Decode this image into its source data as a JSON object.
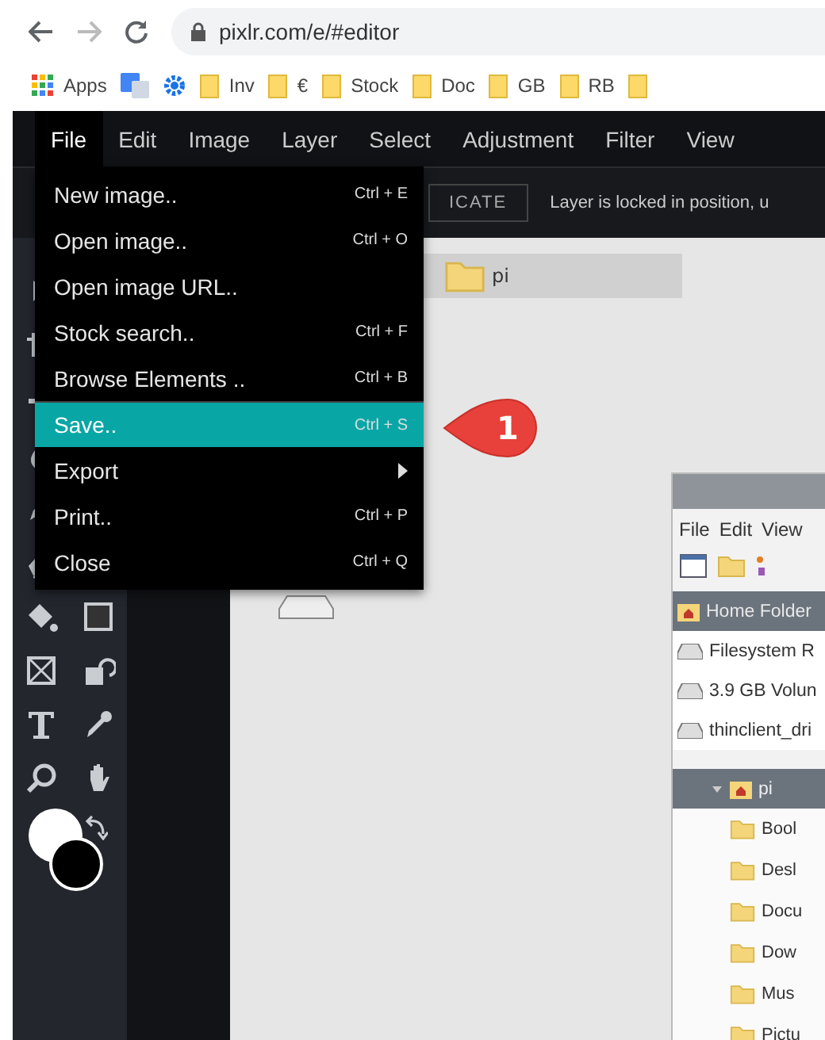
{
  "browser": {
    "url": "pixlr.com/e/#editor",
    "bookmarks": [
      {
        "label": "Apps",
        "kind": "apps"
      },
      {
        "kind": "translate"
      },
      {
        "kind": "gear"
      },
      {
        "label": "Inv",
        "kind": "folder"
      },
      {
        "label": "€",
        "kind": "folder"
      },
      {
        "label": "Stock",
        "kind": "folder"
      },
      {
        "label": "Doc",
        "kind": "folder"
      },
      {
        "label": "GB",
        "kind": "folder"
      },
      {
        "label": "RB",
        "kind": "folder"
      }
    ]
  },
  "menu_bar": [
    {
      "label": "File",
      "selected": true
    },
    {
      "label": "Edit",
      "selected": false
    },
    {
      "label": "Image",
      "selected": false
    },
    {
      "label": "Layer",
      "selected": false
    },
    {
      "label": "Select",
      "selected": false
    },
    {
      "label": "Adjustment",
      "selected": false
    },
    {
      "label": "Filter",
      "selected": false
    },
    {
      "label": "View",
      "selected": false
    }
  ],
  "options_bar": {
    "button": "ICATE",
    "message": "Layer is locked in position, u"
  },
  "file_menu": [
    {
      "label": "New image..",
      "shortcut": "Ctrl + E",
      "selected": false,
      "kind": "item"
    },
    {
      "label": "Open image..",
      "shortcut": "Ctrl + O",
      "selected": false,
      "kind": "item"
    },
    {
      "label": "Open image URL..",
      "selected": false,
      "kind": "item"
    },
    {
      "label": "Stock search..",
      "shortcut": "Ctrl + F",
      "selected": false,
      "kind": "item"
    },
    {
      "label": "Browse Elements ..",
      "shortcut": "Ctrl + B",
      "selected": false,
      "kind": "item"
    },
    {
      "label": "Save..",
      "shortcut": "Ctrl + S",
      "selected": true,
      "kind": "item"
    },
    {
      "label": "Export",
      "selected": false,
      "kind": "submenu"
    },
    {
      "label": "Print..",
      "shortcut": "Ctrl + P",
      "selected": false,
      "kind": "item"
    },
    {
      "label": "Close",
      "shortcut": "Ctrl + Q",
      "selected": false,
      "kind": "item"
    }
  ],
  "callout": {
    "number": "1"
  },
  "canvas": {
    "tab": "pi"
  },
  "file_manager": {
    "menu": [
      "File",
      "Edit",
      "View"
    ],
    "places": [
      {
        "label": "Home Folder",
        "kind": "home",
        "selected": true
      },
      {
        "label": "Filesystem R",
        "kind": "drive",
        "selected": false
      },
      {
        "label": "3.9 GB Volun",
        "kind": "drive",
        "selected": false
      },
      {
        "label": "thinclient_dri",
        "kind": "drive",
        "selected": false
      }
    ],
    "tree": {
      "label": "pi",
      "expanded": true,
      "selected": true,
      "children": [
        {
          "label": "Bool"
        },
        {
          "label": "Desl"
        },
        {
          "label": "Docu"
        },
        {
          "label": "Dow"
        },
        {
          "label": "Mus"
        },
        {
          "label": "Pictu"
        }
      ]
    }
  }
}
